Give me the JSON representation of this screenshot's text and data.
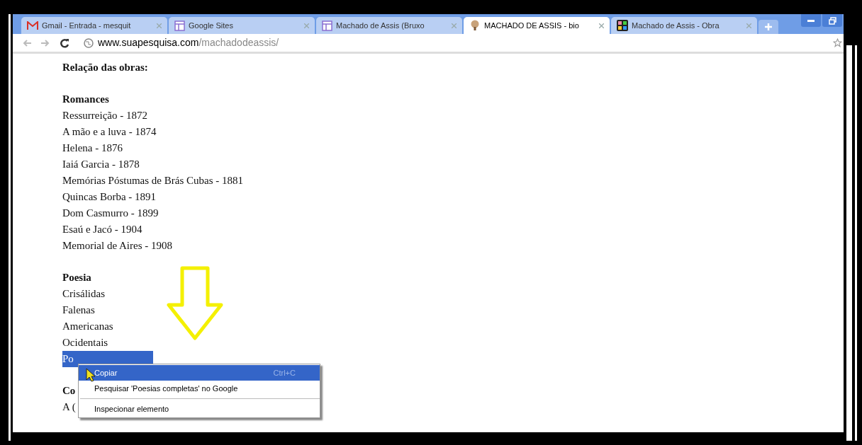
{
  "tabs": [
    {
      "title": "Gmail - Entrada - mesquit",
      "selected": false
    },
    {
      "title": "Google Sites",
      "selected": false
    },
    {
      "title": "Machado de Assis (Bruxo",
      "selected": false
    },
    {
      "title": "MACHADO DE ASSIS - bio",
      "selected": true
    },
    {
      "title": "Machado de Assis - Obra",
      "selected": false
    }
  ],
  "address": {
    "domain": "www.suapesquisa.com",
    "path": "/machadodeassis/"
  },
  "page": {
    "heading": "Relação das obras:",
    "sections": [
      {
        "title": "Romances",
        "items": [
          {
            "text": "Ressurreição - 1872",
            "selected": false
          },
          {
            "text": "A mão e a luva - 1874",
            "selected": false
          },
          {
            "text": "Helena - 1876",
            "selected": false
          },
          {
            "text": "Iaiá Garcia - 1878",
            "selected": false
          },
          {
            "text": "Memórias Póstumas de Brás Cubas - 1881",
            "selected": false
          },
          {
            "text": "Quincas Borba - 1891",
            "selected": false
          },
          {
            "text": "Dom Casmurro - 1899",
            "selected": false
          },
          {
            "text": "Esaú e Jacó - 1904",
            "selected": false
          },
          {
            "text": "Memorial de Aires - 1908",
            "selected": false
          }
        ]
      },
      {
        "title": "Poesia",
        "items": [
          {
            "text": "Crisálidas",
            "selected": false
          },
          {
            "text": "Falenas",
            "selected": false
          },
          {
            "text": "Americanas",
            "selected": false
          },
          {
            "text": "Ocidentais",
            "selected": false
          },
          {
            "text": "Po",
            "selected": true
          }
        ]
      },
      {
        "title": "Co",
        "items": [
          {
            "text": "A (",
            "selected": false
          }
        ]
      }
    ]
  },
  "context_menu": [
    {
      "kind": "item",
      "label": "Copiar",
      "shortcut": "Ctrl+C",
      "selected": true
    },
    {
      "kind": "item",
      "label": "Pesquisar 'Poesias completas' no Google",
      "selected": false
    },
    {
      "kind": "separator"
    },
    {
      "kind": "item",
      "label": "Inspecionar elemento",
      "selected": false
    }
  ]
}
